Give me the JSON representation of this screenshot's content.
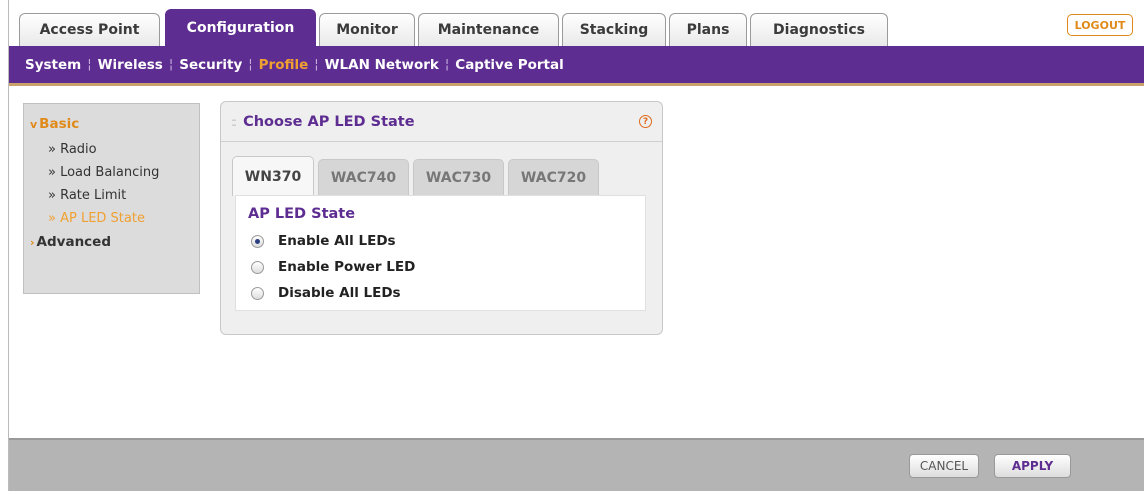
{
  "top_tabs": [
    {
      "label": "Access Point"
    },
    {
      "label": "Configuration"
    },
    {
      "label": "Monitor"
    },
    {
      "label": "Maintenance"
    },
    {
      "label": "Stacking"
    },
    {
      "label": "Plans"
    },
    {
      "label": "Diagnostics"
    }
  ],
  "active_top_tab": "Configuration",
  "logout_label": "LOGOUT",
  "sub_nav": [
    {
      "label": "System"
    },
    {
      "label": "Wireless"
    },
    {
      "label": "Security"
    },
    {
      "label": "Profile"
    },
    {
      "label": "WLAN Network"
    },
    {
      "label": "Captive Portal"
    }
  ],
  "active_sub_nav": "Profile",
  "left_nav": {
    "basic_label": "Basic",
    "items": [
      {
        "label": "» Radio"
      },
      {
        "label": "» Load Balancing"
      },
      {
        "label": "» Rate Limit"
      },
      {
        "label": "» AP LED State"
      }
    ],
    "advanced_label": "Advanced"
  },
  "panel": {
    "title": "Choose AP LED State",
    "help_glyph": "?",
    "device_tabs": [
      {
        "label": "WN370"
      },
      {
        "label": "WAC740"
      },
      {
        "label": "WAC730"
      },
      {
        "label": "WAC720"
      }
    ],
    "active_device_tab": "WN370",
    "section_title": "AP LED State",
    "options": [
      {
        "label": "Enable All LEDs",
        "selected": true
      },
      {
        "label": "Enable Power LED",
        "selected": false
      },
      {
        "label": "Disable All LEDs",
        "selected": false
      }
    ]
  },
  "footer": {
    "cancel_label": "CANCEL",
    "apply_label": "APPLY"
  },
  "colors": {
    "brand_purple": "#5e2d91",
    "accent_orange": "#f0a030"
  }
}
